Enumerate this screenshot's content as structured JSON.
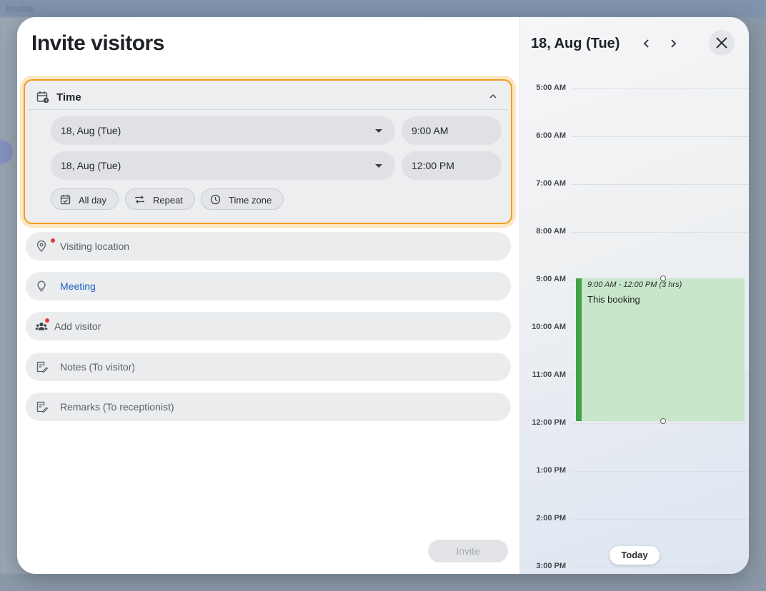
{
  "backdrop": {
    "ghost_title": "Invite"
  },
  "form": {
    "title": "Invite visitors",
    "time_section": {
      "label": "Time",
      "start_date": "18, Aug (Tue)",
      "start_time": "9:00 AM",
      "end_date": "18, Aug (Tue)",
      "end_time": "12:00 PM",
      "chips": {
        "all_day": "All day",
        "repeat": "Repeat",
        "time_zone": "Time zone"
      }
    },
    "fields": {
      "location_placeholder": "Visiting location",
      "purpose_value": "Meeting",
      "visitor_placeholder": "Add visitor",
      "notes_placeholder": "Notes (To visitor)",
      "remarks_placeholder": "Remarks (To receptionist)"
    },
    "invite_button": "Invite"
  },
  "calendar": {
    "date_title": "18, Aug (Tue)",
    "hours": [
      "5:00 AM",
      "6:00 AM",
      "7:00 AM",
      "8:00 AM",
      "9:00 AM",
      "10:00 AM",
      "11:00 AM",
      "12:00 PM",
      "1:00 PM",
      "2:00 PM",
      "3:00 PM"
    ],
    "booking": {
      "time_range": "9:00 AM - 12:00 PM (3 hrs)",
      "title": "This booking"
    },
    "today_button": "Today"
  },
  "colors": {
    "focus_ring": "#f39b1e",
    "booking_fill": "#c8e6c9",
    "booking_accent": "#43a047",
    "link": "#1f63c0",
    "required_dot": "#e53935"
  }
}
